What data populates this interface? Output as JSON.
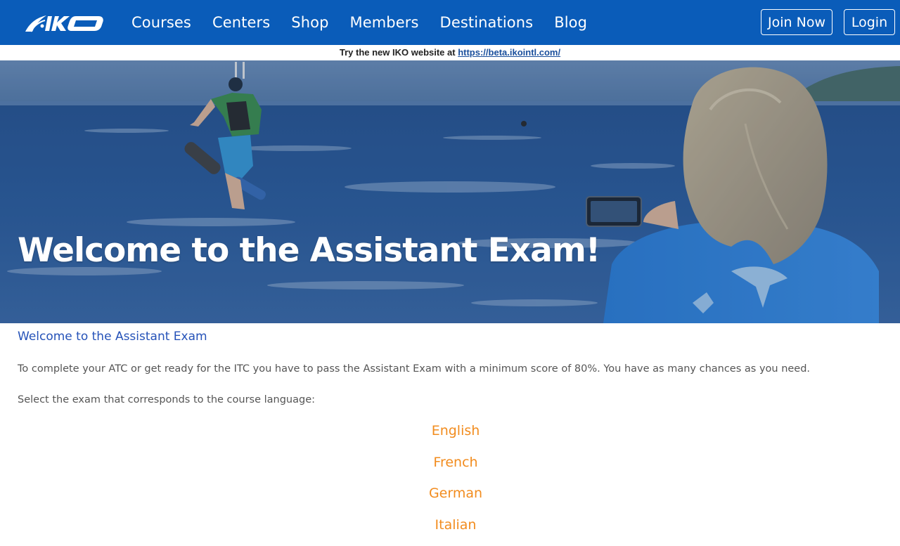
{
  "nav": {
    "logo_text": "IKO",
    "links": [
      "Courses",
      "Centers",
      "Shop",
      "Members",
      "Destinations",
      "Blog"
    ],
    "join_label": "Join Now",
    "login_label": "Login",
    "bg_color": "#0a5cb9"
  },
  "banner": {
    "prefix": "Try the new IKO website at ",
    "link_text": "https://beta.ikointl.com/"
  },
  "hero": {
    "title": "Welcome to the Assistant Exam!"
  },
  "content": {
    "heading": "Welcome to the Assistant Exam",
    "paragraph_1": "To complete your ATC or get ready for the ITC you have to pass the Assistant Exam with a minimum score of 80%. You have as many chances as you need.",
    "paragraph_2": "Select the exam that corresponds to the course language:",
    "languages": [
      "English",
      "French",
      "German",
      "Italian"
    ],
    "link_color": "#f28c1e",
    "heading_color": "#2552b8"
  }
}
